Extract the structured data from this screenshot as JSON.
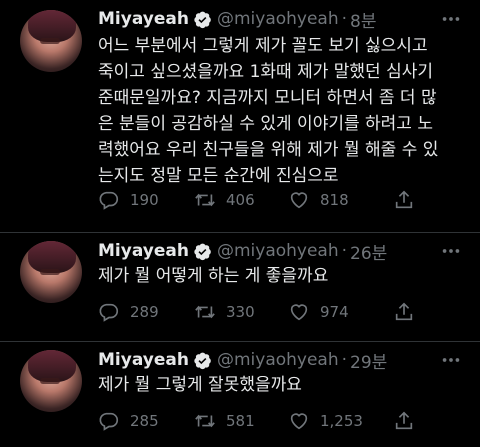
{
  "tweets": [
    {
      "name": "Miyayeah",
      "handle": "@miyaohyeah",
      "separator": "·",
      "time": "8분",
      "text_lines": [
        "어느 부분에서 그렇게 제가 꼴도 보기 싫으시고",
        "죽이고 싶으셨을까요 1화때 제가 말했던 심사기",
        "준때문일까요? 지금까지 모니터 하면서 좀 더 많",
        "은 분들이 공감하실 수 있게 이야기를 하려고 노",
        "력했어요 우리 친구들을 위해 제가 뭘 해줄 수 있",
        "는지도 정말 모든 순간에 진심으로"
      ],
      "replies": "190",
      "retweets": "406",
      "likes": "818"
    },
    {
      "name": "Miyayeah",
      "handle": "@miyaohyeah",
      "separator": "·",
      "time": "26분",
      "text_lines": [
        "제가 뭘 어떻게 하는 게 좋을까요"
      ],
      "replies": "289",
      "retweets": "330",
      "likes": "974"
    },
    {
      "name": "Miyayeah",
      "handle": "@miyaohyeah",
      "separator": "·",
      "time": "29분",
      "text_lines": [
        "제가 뭘 그렇게 잘못했을까요"
      ],
      "replies": "285",
      "retweets": "581",
      "likes": "1,253"
    }
  ],
  "icons": {
    "verified": "verified-badge-icon",
    "more": "more-icon",
    "reply": "reply-icon",
    "retweet": "retweet-icon",
    "like": "heart-icon",
    "share": "share-icon"
  },
  "colors": {
    "background": "#000000",
    "text": "#e7e9ea",
    "muted": "#71767b",
    "verified": "#1d9bf0",
    "divider": "#2f3336"
  }
}
